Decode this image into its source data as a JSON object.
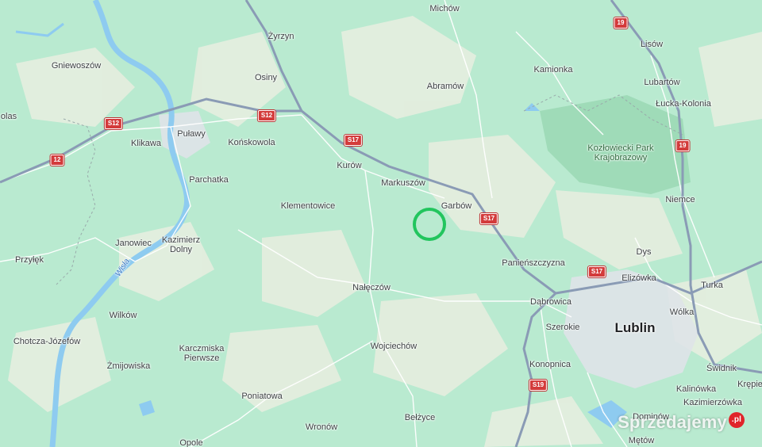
{
  "map": {
    "colors": {
      "land": "#b9ead0",
      "farmland": "#e8eee0",
      "forest": "#9fdbb8",
      "water": "#8ecbf0",
      "road_major": "#8a9bb5",
      "road_minor": "#ffffff",
      "urban": "#dfe3e8",
      "marker": "#22c55e"
    },
    "marker": {
      "name": "location-circle",
      "color": "#22c55e"
    },
    "places": [
      {
        "id": "michow",
        "label": "Michów",
        "kind": "town"
      },
      {
        "id": "zyrzyn",
        "label": "Żyrzyn",
        "kind": "town"
      },
      {
        "id": "lisow",
        "label": "Lisów",
        "kind": "town"
      },
      {
        "id": "gniewoszow",
        "label": "Gniewoszów",
        "kind": "town"
      },
      {
        "id": "kamionka",
        "label": "Kamionka",
        "kind": "town"
      },
      {
        "id": "osiny",
        "label": "Osiny",
        "kind": "town"
      },
      {
        "id": "lubartow",
        "label": "Lubartów",
        "kind": "town"
      },
      {
        "id": "abramow",
        "label": "Abramów",
        "kind": "town"
      },
      {
        "id": "lucka",
        "label": "Łucka-Kolonia",
        "kind": "town"
      },
      {
        "id": "olas",
        "label": "olas",
        "kind": "town"
      },
      {
        "id": "pulawy",
        "label": "Puławy",
        "kind": "town"
      },
      {
        "id": "konskowola",
        "label": "Końskowola",
        "kind": "town"
      },
      {
        "id": "klikawa",
        "label": "Klikawa",
        "kind": "town"
      },
      {
        "id": "kozlowiecki",
        "label": "Kozłowiecki Park Krajobrazowy",
        "kind": "park"
      },
      {
        "id": "kurow",
        "label": "Kurów",
        "kind": "town"
      },
      {
        "id": "parchatka",
        "label": "Parchatka",
        "kind": "town"
      },
      {
        "id": "markuszow",
        "label": "Markuszów",
        "kind": "town"
      },
      {
        "id": "niemce",
        "label": "Niemce",
        "kind": "town"
      },
      {
        "id": "klementowice",
        "label": "Klementowice",
        "kind": "town"
      },
      {
        "id": "garbow",
        "label": "Garbów",
        "kind": "town"
      },
      {
        "id": "janowiec",
        "label": "Janowiec",
        "kind": "town"
      },
      {
        "id": "kazimierz",
        "label": "Kazimierz Dolny",
        "kind": "town"
      },
      {
        "id": "dys",
        "label": "Dys",
        "kind": "town"
      },
      {
        "id": "przylek",
        "label": "Przyłęk",
        "kind": "town"
      },
      {
        "id": "panienszczyzna",
        "label": "Panieńszczyzna",
        "kind": "town"
      },
      {
        "id": "wisla",
        "label": "Wisła",
        "kind": "river"
      },
      {
        "id": "elizowka",
        "label": "Elizówka",
        "kind": "town"
      },
      {
        "id": "turka",
        "label": "Turka",
        "kind": "town"
      },
      {
        "id": "naleczow",
        "label": "Nałęczów",
        "kind": "town"
      },
      {
        "id": "dabrowica",
        "label": "Dąbrowica",
        "kind": "town"
      },
      {
        "id": "wolka",
        "label": "Wólka",
        "kind": "town"
      },
      {
        "id": "wilkow",
        "label": "Wilków",
        "kind": "town"
      },
      {
        "id": "szerokie",
        "label": "Szerokie",
        "kind": "town"
      },
      {
        "id": "lublin",
        "label": "Lublin",
        "kind": "city"
      },
      {
        "id": "chotcza",
        "label": "Chotcza-Józefów",
        "kind": "town"
      },
      {
        "id": "wojciechow",
        "label": "Wojciechów",
        "kind": "town"
      },
      {
        "id": "karczmiska",
        "label": "Karczmiska Pierwsze",
        "kind": "town"
      },
      {
        "id": "konopnica",
        "label": "Konopnica",
        "kind": "town"
      },
      {
        "id": "zmijowiska",
        "label": "Żmijowiska",
        "kind": "town"
      },
      {
        "id": "swidnik",
        "label": "Świdnik",
        "kind": "town"
      },
      {
        "id": "krepiec",
        "label": "Krępie",
        "kind": "town"
      },
      {
        "id": "kalinowka",
        "label": "Kalinówka",
        "kind": "town"
      },
      {
        "id": "poniatowa",
        "label": "Poniatowa",
        "kind": "town"
      },
      {
        "id": "kazimierzowka",
        "label": "Kazimierzówka",
        "kind": "town"
      },
      {
        "id": "belzyce",
        "label": "Bełżyce",
        "kind": "town"
      },
      {
        "id": "wronow",
        "label": "Wronów",
        "kind": "town"
      },
      {
        "id": "dominow",
        "label": "Dominów",
        "kind": "town"
      },
      {
        "id": "opole",
        "label": "Opole",
        "kind": "town"
      },
      {
        "id": "metow",
        "label": "Mętów",
        "kind": "town"
      }
    ],
    "shields": [
      {
        "id": "s12a",
        "label": "S12"
      },
      {
        "id": "s12b",
        "label": "S12"
      },
      {
        "id": "n12",
        "label": "12"
      },
      {
        "id": "s17a",
        "label": "S17"
      },
      {
        "id": "s17b",
        "label": "S17"
      },
      {
        "id": "s17c",
        "label": "S17"
      },
      {
        "id": "n19a",
        "label": "19"
      },
      {
        "id": "n19b",
        "label": "19"
      },
      {
        "id": "s19",
        "label": "S19"
      }
    ],
    "watermark": {
      "text": "Sprzedajemy",
      "badge": ".pl"
    }
  }
}
